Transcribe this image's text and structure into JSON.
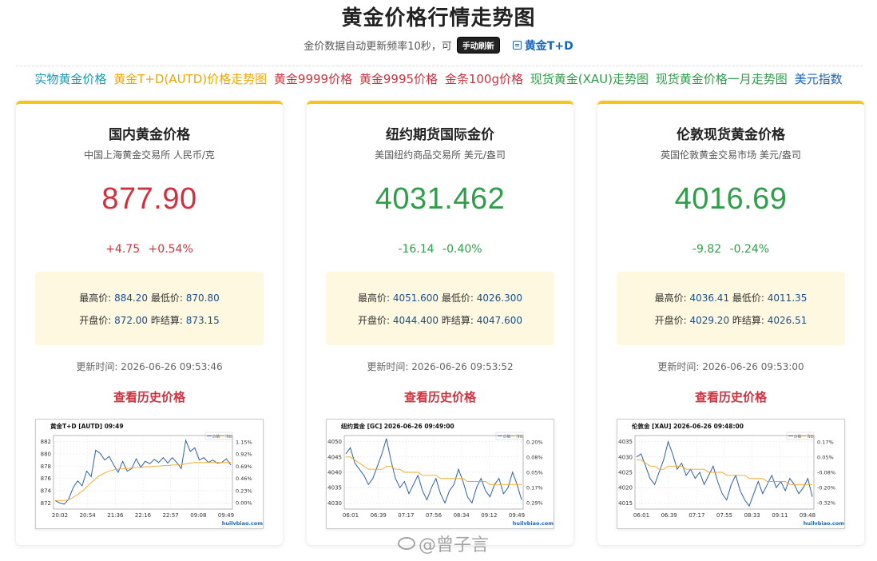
{
  "header": {
    "title": "黄金价格行情走势图",
    "subtitle": "金价数据自动更新频率10秒，可",
    "refresh_label": "手动刷新",
    "td_link": "黄金T+D"
  },
  "nav": [
    {
      "label": "实物黄金价格",
      "color": "#1a9bb0"
    },
    {
      "label": "黄金T+D(AUTD)价格走势图",
      "color": "#f0a500"
    },
    {
      "label": "黄金9999价格",
      "color": "#d0313d"
    },
    {
      "label": "黄金9995价格",
      "color": "#d0313d"
    },
    {
      "label": "金条100g价格",
      "color": "#d0313d"
    },
    {
      "label": "现货黄金(XAU)走势图",
      "color": "#2e9e4a"
    },
    {
      "label": "现货黄金价格一月走势图",
      "color": "#2e9e4a"
    },
    {
      "label": "美元指数",
      "color": "#1565c0"
    }
  ],
  "cards": [
    {
      "title": "国内黄金价格",
      "subtitle": "中国上海黄金交易所 人民币/克",
      "price": "877.90",
      "change": "+4.75",
      "change_pct": "+0.54%",
      "direction": "up",
      "high_label": "最高价:",
      "high": "884.20",
      "low_label": "最低价:",
      "low": "870.80",
      "open_label": "开盘价:",
      "open": "872.00",
      "prev_label": "昨结算:",
      "prev": "873.15",
      "update": "更新时间: 2026-06-26 09:53:46",
      "history": "查看历史价格"
    },
    {
      "title": "纽约期货国际金价",
      "subtitle": "美国纽约商品交易所 美元/盎司",
      "price": "4031.462",
      "change": "-16.14",
      "change_pct": "-0.40%",
      "direction": "down",
      "high_label": "最高价:",
      "high": "4051.600",
      "low_label": "最低价:",
      "low": "4026.300",
      "open_label": "开盘价:",
      "open": "4044.400",
      "prev_label": "昨结算:",
      "prev": "4047.600",
      "update": "更新时间: 2026-06-26 09:53:52",
      "history": "查看历史价格"
    },
    {
      "title": "伦敦现货黄金价格",
      "subtitle": "英国伦敦黄金交易市场 美元/盎司",
      "price": "4016.69",
      "change": "-9.82",
      "change_pct": "-0.24%",
      "direction": "down",
      "high_label": "最高价:",
      "high": "4036.41",
      "low_label": "最低价:",
      "low": "4011.35",
      "open_label": "开盘价:",
      "open": "4029.20",
      "prev_label": "昨结算:",
      "prev": "4026.51",
      "update": "更新时间: 2026-06-26 09:53:00",
      "history": "查看历史价格"
    }
  ],
  "chart_data": [
    {
      "type": "line",
      "title": "黄金T+D [AUTD]  09:49",
      "legend": [
        "价格",
        "均价"
      ],
      "x_ticks": [
        "20:02",
        "20:54",
        "21:36",
        "22:16",
        "22:57",
        "09:08",
        "09:49"
      ],
      "y_ticks": [
        872,
        874,
        876,
        878,
        880,
        882
      ],
      "y2_ticks": [
        "1.15%",
        "0.92%",
        "0.69%",
        "0.46%",
        "0.23%",
        "0.00%"
      ],
      "ylim": [
        871,
        883
      ],
      "watermark": "huilvbiao.com",
      "series": [
        {
          "values": [
            872.4,
            872.0,
            871.8,
            872.6,
            874.5,
            875.6,
            874.8,
            877.2,
            876.3,
            880.6,
            880.1,
            879.0,
            879.6,
            878.2,
            877.0,
            878.8,
            877.2,
            877.6,
            879.2,
            877.8,
            878.8,
            878.4,
            879.1,
            878.6,
            879.4,
            878.5,
            879.4,
            878.6,
            877.6,
            882.2,
            880.4,
            881.0,
            879.0,
            879.4,
            878.6,
            879.0,
            878.5,
            878.6,
            879.2,
            878.2
          ]
        },
        {
          "values": [
            872.4,
            872.4,
            872.4,
            872.5,
            872.9,
            873.4,
            873.9,
            874.6,
            875.3,
            876.0,
            876.5,
            876.9,
            877.2,
            877.4,
            877.5,
            877.6,
            877.6,
            877.7,
            877.8,
            877.8,
            877.9,
            877.9,
            878.0,
            878.0,
            878.1,
            878.1,
            878.2,
            878.2,
            878.2,
            878.4,
            878.5,
            878.6,
            878.6,
            878.6,
            878.6,
            878.6,
            878.6,
            878.6,
            878.6,
            878.6
          ]
        }
      ]
    },
    {
      "type": "line",
      "title": "纽约黄金 [GC]  2026-06-26 09:49:00",
      "legend": [
        "价格",
        "均价"
      ],
      "x_ticks": [
        "06:01",
        "06:39",
        "07:17",
        "07:56",
        "08:34",
        "09:12",
        "09:49"
      ],
      "y_ticks": [
        4030,
        4035,
        4040,
        4045,
        4050
      ],
      "y2_ticks": [
        "0.20%",
        "0.08%",
        "0.05%",
        "0.17%",
        "0.29%"
      ],
      "ylim": [
        4028,
        4052
      ],
      "watermark": "huilvbiao.com",
      "series": [
        {
          "values": [
            4046,
            4048,
            4043,
            4041,
            4039,
            4036,
            4038,
            4042,
            4046,
            4051,
            4044,
            4038,
            4035,
            4037,
            4033,
            4036,
            4039,
            4034,
            4031,
            4035,
            4038,
            4033,
            4030,
            4034,
            4036,
            4041,
            4037,
            4032,
            4030,
            4035,
            4038,
            4034,
            4032,
            4036,
            4038,
            4033,
            4035,
            4040,
            4036,
            4031
          ]
        },
        {
          "values": [
            4045,
            4045,
            4044,
            4043,
            4042,
            4041,
            4041,
            4041,
            4041,
            4042,
            4042,
            4041,
            4041,
            4040,
            4040,
            4040,
            4040,
            4039,
            4039,
            4039,
            4039,
            4038,
            4038,
            4038,
            4038,
            4038,
            4038,
            4037,
            4037,
            4037,
            4037,
            4037,
            4036,
            4036,
            4036,
            4036,
            4036,
            4036,
            4036,
            4036
          ]
        }
      ]
    },
    {
      "type": "line",
      "title": "伦敦金 [XAU]  2026-06-26 09:48:00",
      "legend": [
        "价格",
        "均价"
      ],
      "x_ticks": [
        "06:01",
        "06:39",
        "07:17",
        "07:55",
        "08:33",
        "09:11",
        "09:48"
      ],
      "y_ticks": [
        4015,
        4020,
        4025,
        4030,
        4035
      ],
      "y2_ticks": [
        "0.17%",
        "0.05%",
        "-0.08%",
        "-0.20%",
        "-0.32%"
      ],
      "ylim": [
        4013,
        4037
      ],
      "watermark": "huilvbiao.com",
      "series": [
        {
          "values": [
            4030,
            4031,
            4027,
            4023,
            4021,
            4025,
            4029,
            4035,
            4031,
            4026,
            4028,
            4024,
            4026,
            4023,
            4025,
            4021,
            4024,
            4027,
            4022,
            4018,
            4016,
            4021,
            4024,
            4019,
            4016,
            4014,
            4018,
            4022,
            4018,
            4021,
            4024,
            4020,
            4022,
            4019,
            4023,
            4021,
            4018,
            4020,
            4023,
            4017
          ]
        },
        {
          "values": [
            4029,
            4029,
            4028,
            4027,
            4027,
            4026,
            4026,
            4027,
            4027,
            4027,
            4027,
            4026,
            4026,
            4026,
            4026,
            4026,
            4025,
            4025,
            4025,
            4025,
            4024,
            4024,
            4024,
            4024,
            4024,
            4023,
            4023,
            4023,
            4023,
            4022,
            4022,
            4022,
            4022,
            4022,
            4021,
            4021,
            4021,
            4021,
            4021,
            4021
          ]
        }
      ]
    }
  ],
  "watermark": "@曾子言"
}
